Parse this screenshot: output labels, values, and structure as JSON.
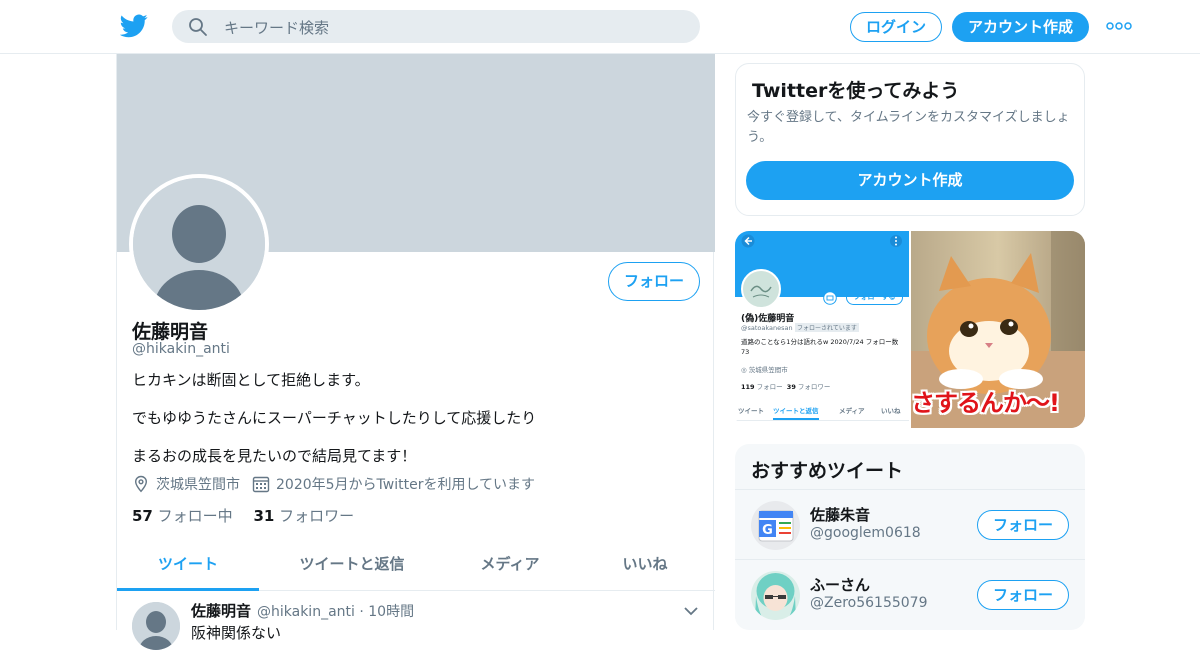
{
  "header": {
    "search_placeholder": "キーワード検索",
    "login_label": "ログイン",
    "signup_label": "アカウント作成"
  },
  "profile": {
    "name": "佐藤明音",
    "handle": "@hikakin_anti",
    "follow_label": "フォロー",
    "bio": [
      "ヒカキンは断固として拒絶します。",
      "でもゆゆうたさんにスーパーチャットしたりして応援したり",
      "まるおの成長を見たいので結局見てます！"
    ],
    "location": "茨城県笠間市",
    "joined": "2020年5月からTwitterを利用しています",
    "following_count": "57",
    "following_label": "フォロー中",
    "followers_count": "31",
    "followers_label": "フォロワー"
  },
  "tabs": [
    "ツイート",
    "ツイートと返信",
    "メディア",
    "いいね"
  ],
  "tweet": {
    "name": "佐藤明音",
    "handle": "@hikakin_anti",
    "time": "10時間",
    "text": "阪神関係ない"
  },
  "signup_card": {
    "title": "Twitterを使ってみよう",
    "desc": "今すぐ登録して、タイムラインをカスタマイズしましょう。",
    "button": "アカウント作成"
  },
  "media": {
    "screenshot": {
      "name": "(偽)佐藤明音",
      "handle": "@satoakanesan",
      "follows_you": "フォローされています",
      "follow_btn": "フォローする",
      "bio": "道路のことなら1分は語れるw 2020/7/24 フォロー数73",
      "location": "茨城県笠間市",
      "following": "119",
      "following_label": "フォロー",
      "followers": "39",
      "followers_label": "フォロワー",
      "tabs": [
        "ツイート",
        "ツイートと返信",
        "メディア",
        "いいね"
      ]
    },
    "cat_caption": "さするんか〜!"
  },
  "recommended": {
    "title": "おすすめツイート",
    "items": [
      {
        "name": "佐藤朱音",
        "handle": "@googlem0618",
        "button": "フォロー"
      },
      {
        "name": "ふーさん",
        "handle": "@Zero56155079",
        "button": "フォロー"
      }
    ]
  },
  "colors": {
    "accent": "#1da1f2",
    "muted": "#657786",
    "banner": "#ccd6dd"
  }
}
